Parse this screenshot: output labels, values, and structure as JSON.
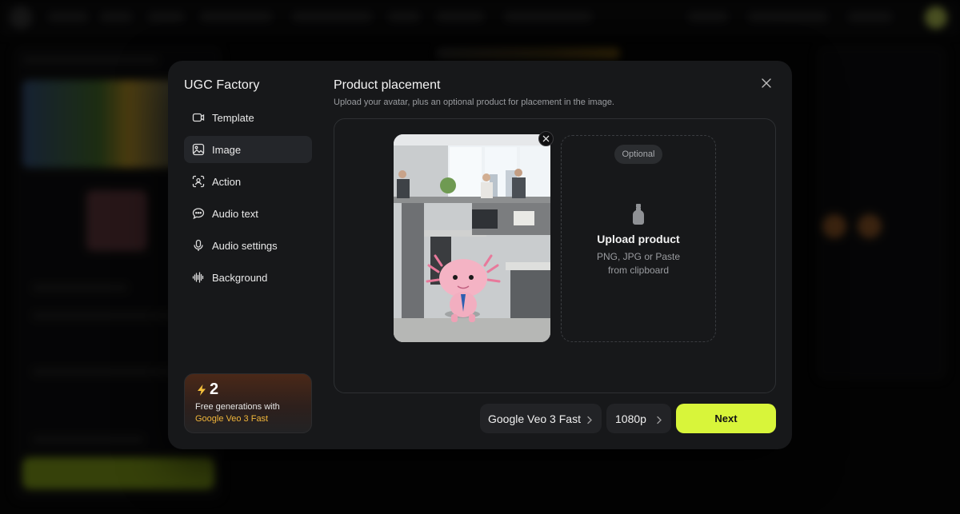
{
  "modal": {
    "app_title": "UGC Factory",
    "close_icon": "close-icon"
  },
  "menu": {
    "items": [
      {
        "label": "Template",
        "icon": "video-frame-icon"
      },
      {
        "label": "Image",
        "icon": "image-icon",
        "active": true
      },
      {
        "label": "Action",
        "icon": "person-scan-icon"
      },
      {
        "label": "Audio text",
        "icon": "speech-bubble-icon"
      },
      {
        "label": "Audio settings",
        "icon": "microphone-icon"
      },
      {
        "label": "Background",
        "icon": "waveform-icon"
      }
    ]
  },
  "promo": {
    "count": "2",
    "icon": "lightning-icon",
    "text": "Free generations with",
    "model": "Google Veo 3 Fast"
  },
  "content": {
    "title": "Product placement",
    "subtitle": "Upload your avatar, plus an optional product for placement in the image."
  },
  "product_slot": {
    "badge": "Optional",
    "icon": "bottle-icon",
    "title": "Upload product",
    "hint_line1": "PNG, JPG or Paste",
    "hint_line2": "from clipboard"
  },
  "footer": {
    "model": "Google Veo 3 Fast",
    "resolution": "1080p",
    "next_label": "Next"
  },
  "colors": {
    "accent": "#d8f53a",
    "promo_highlight": "#f0b53a",
    "modal_bg": "#17181a"
  }
}
